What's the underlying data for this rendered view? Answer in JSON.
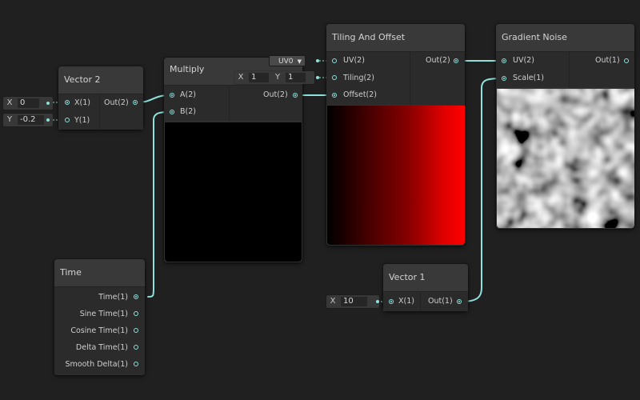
{
  "nodes": {
    "vector2": {
      "title": "Vector 2",
      "inputs": [
        {
          "label": "X(1)"
        },
        {
          "label": "Y(1)"
        }
      ],
      "output": "Out(2)",
      "fields": [
        {
          "axis": "X",
          "value": "0"
        },
        {
          "axis": "Y",
          "value": "-0.2"
        }
      ]
    },
    "multiply": {
      "title": "Multiply",
      "inputs": [
        {
          "label": "A(2)"
        },
        {
          "label": "B(2)"
        }
      ],
      "output": "Out(2)",
      "tiling_field": {
        "x_label": "X",
        "x_value": "1",
        "y_label": "Y",
        "y_value": "1"
      }
    },
    "tiling": {
      "title": "Tiling And Offset",
      "inputs": [
        {
          "label": "UV(2)"
        },
        {
          "label": "Tiling(2)"
        },
        {
          "label": "Offset(2)"
        }
      ],
      "output": "Out(2)",
      "uv_dropdown": "UV0"
    },
    "noise": {
      "title": "Gradient Noise",
      "inputs": [
        {
          "label": "UV(2)"
        },
        {
          "label": "Scale(1)"
        }
      ],
      "output": "Out(1)"
    },
    "time": {
      "title": "Time",
      "outputs": [
        {
          "label": "Time(1)"
        },
        {
          "label": "Sine Time(1)"
        },
        {
          "label": "Cosine Time(1)"
        },
        {
          "label": "Delta Time(1)"
        },
        {
          "label": "Smooth Delta(1)"
        }
      ]
    },
    "vector1": {
      "title": "Vector 1",
      "input": "X(1)",
      "output": "Out(1)",
      "field": {
        "axis": "X",
        "value": "10"
      }
    }
  },
  "colors": {
    "background": "#202020",
    "wire": "#8de3dc",
    "node": "#303030"
  },
  "icons": {
    "port": "port-dot-icon",
    "dropdown": "dropdown-arrow-icon"
  }
}
